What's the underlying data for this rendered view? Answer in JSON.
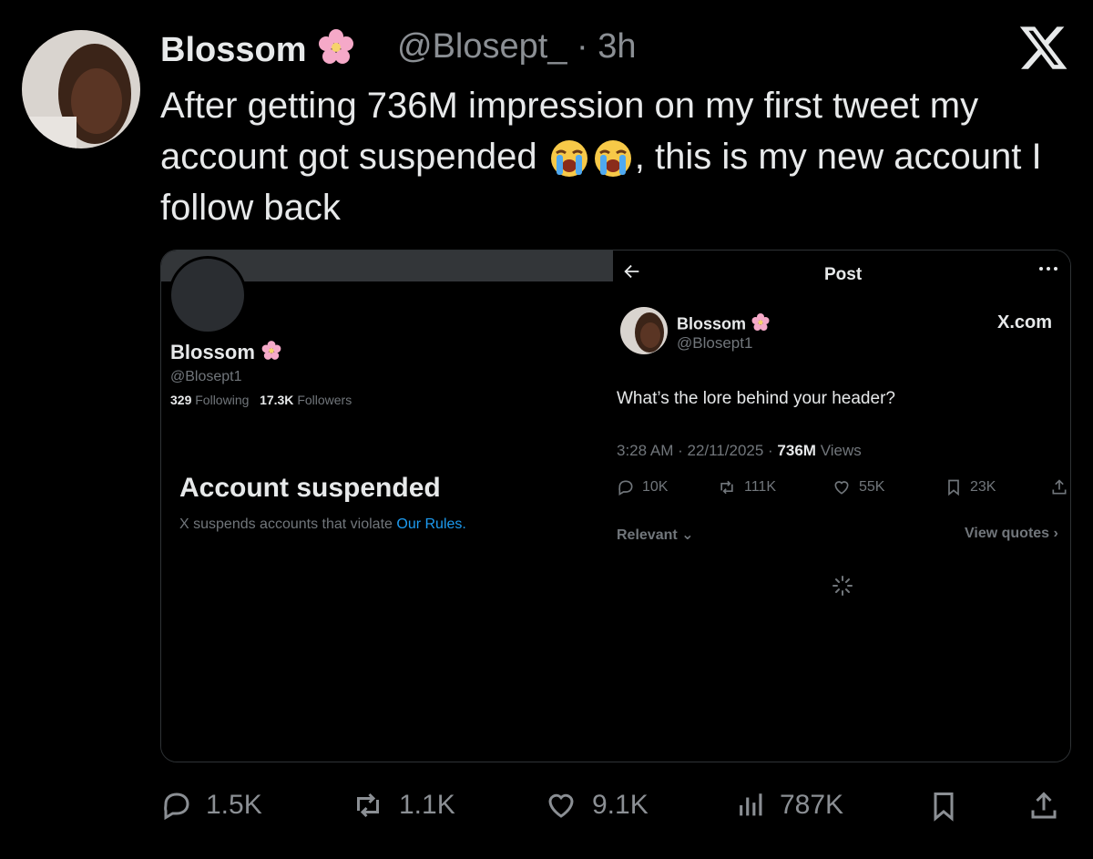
{
  "tweet": {
    "name": "Blossom",
    "handle": "@Blosept_",
    "dot": "·",
    "time": "3h",
    "text_part1": "After getting 736M impression on my first tweet my account got suspended",
    "text_part2": ", this is my new account I follow back",
    "logo_icon": "x-logo-icon",
    "emoji_icons": [
      "loudly-crying-face-emoji",
      "loudly-crying-face-emoji"
    ]
  },
  "left_screenshot": {
    "name": "Blossom",
    "handle": "@Blosept1",
    "following_count": "329",
    "following_label": "Following",
    "followers_count": "17.3K",
    "followers_label": "Followers",
    "suspended_title": "Account suspended",
    "suspended_text": "X suspends accounts that violate",
    "suspended_link": "Our Rules."
  },
  "right_screenshot": {
    "header_title": "Post",
    "back_icon": "arrow-left-icon",
    "more_icon": "more-horizontal-icon",
    "name": "Blossom",
    "handle": "@Blosept1",
    "site": "X.com",
    "body": "What’s the lore behind your header?",
    "time": "3:28 AM",
    "date": "22/11/2025",
    "views_count": "736M",
    "views_label": "Views",
    "replies": "10K",
    "reposts": "111K",
    "likes": "55K",
    "bookmarks": "23K",
    "sort_label": "Relevant",
    "view_quotes": "View quotes"
  },
  "actions": {
    "replies": "1.5K",
    "reposts": "1.1K",
    "likes": "9.1K",
    "views": "787K"
  },
  "colors": {
    "background": "#000000",
    "text": "#e7e9ea",
    "secondary": "#71767b",
    "link": "#1d9bf0"
  }
}
